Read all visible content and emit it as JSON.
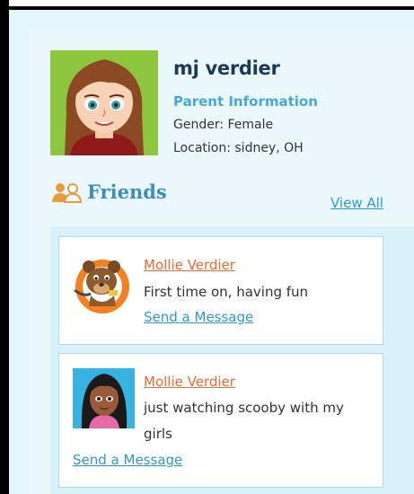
{
  "profile": {
    "username": "mj verdier",
    "parent_info_label": "Parent Information",
    "gender": "Gender: Female",
    "location": "Location: sidney, OH"
  },
  "friends": {
    "title": "Friends",
    "view_all_label": "View All",
    "items": [
      {
        "name": "Mollie Verdier",
        "status": "First time on, having fun",
        "send_label": "Send a Message",
        "avatar_icon": "bear-avatar-icon"
      },
      {
        "name": "Mollie Verdier",
        "status": "just watching scooby with my girls",
        "send_label": "Send a Message",
        "avatar_icon": "girl-avatar-icon"
      }
    ]
  },
  "colors": {
    "username": "#1b3a56",
    "link_blue": "#2d9ad6",
    "friend_name": "#ef6a2c",
    "panel_bg": "#eaf8fc",
    "avatar_bg": "#8cc63f"
  }
}
